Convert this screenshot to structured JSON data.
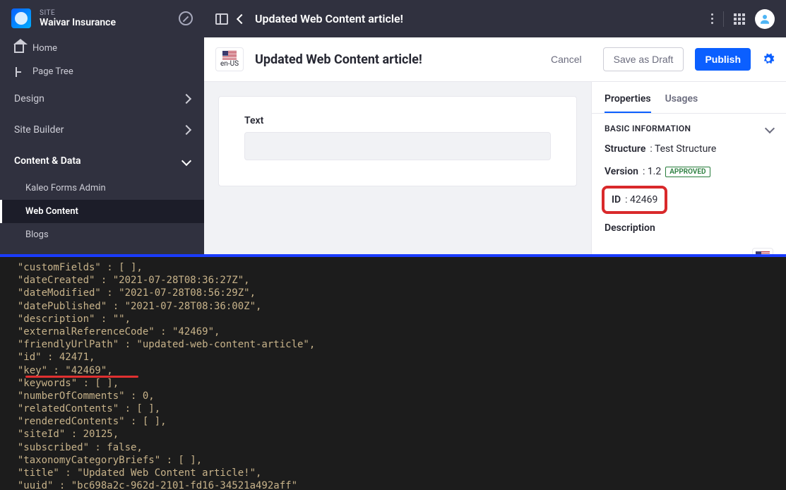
{
  "site": {
    "label": "SITE",
    "name": "Waivar Insurance"
  },
  "sidebar": {
    "home": "Home",
    "pagetree": "Page Tree",
    "design": "Design",
    "sitebuilder": "Site Builder",
    "contentdata": "Content & Data",
    "items": [
      {
        "label": "Kaleo Forms Admin"
      },
      {
        "label": "Web Content"
      },
      {
        "label": "Blogs"
      }
    ]
  },
  "topbar": {
    "title": "Updated Web Content article!"
  },
  "actions": {
    "locale": "en-US",
    "title": "Updated Web Content article!",
    "cancel": "Cancel",
    "draft": "Save as Draft",
    "publish": "Publish"
  },
  "form": {
    "text_label": "Text"
  },
  "tabs": {
    "properties": "Properties",
    "usages": "Usages"
  },
  "props": {
    "section": "BASIC INFORMATION",
    "structure_label": "Structure",
    "structure_value": ": Test Structure",
    "version_label": "Version",
    "version_value": ": 1.2",
    "approved": "APPROVED",
    "id_label": "ID",
    "id_value": ": 42469",
    "description_label": "Description"
  },
  "terminal": {
    "lines": [
      "  \"customFields\" : [ ],",
      "  \"dateCreated\" : \"2021-07-28T08:36:27Z\",",
      "  \"dateModified\" : \"2021-07-28T08:56:29Z\",",
      "  \"datePublished\" : \"2021-07-28T08:36:00Z\",",
      "  \"description\" : \"\",",
      "  \"externalReferenceCode\" : \"42469\",",
      "  \"friendlyUrlPath\" : \"updated-web-content-article\",",
      "  \"id\" : 42471,",
      "  \"key\" : \"42469\",",
      "  \"keywords\" : [ ],",
      "  \"numberOfComments\" : 0,",
      "  \"relatedContents\" : [ ],",
      "  \"renderedContents\" : [ ],",
      "  \"siteId\" : 20125,",
      "  \"subscribed\" : false,",
      "  \"taxonomyCategoryBriefs\" : [ ],",
      "  \"title\" : \"Updated Web Content article!\",",
      "  \"uuid\" : \"bc698a2c-962d-2101-fd16-34521a492aff\""
    ]
  }
}
